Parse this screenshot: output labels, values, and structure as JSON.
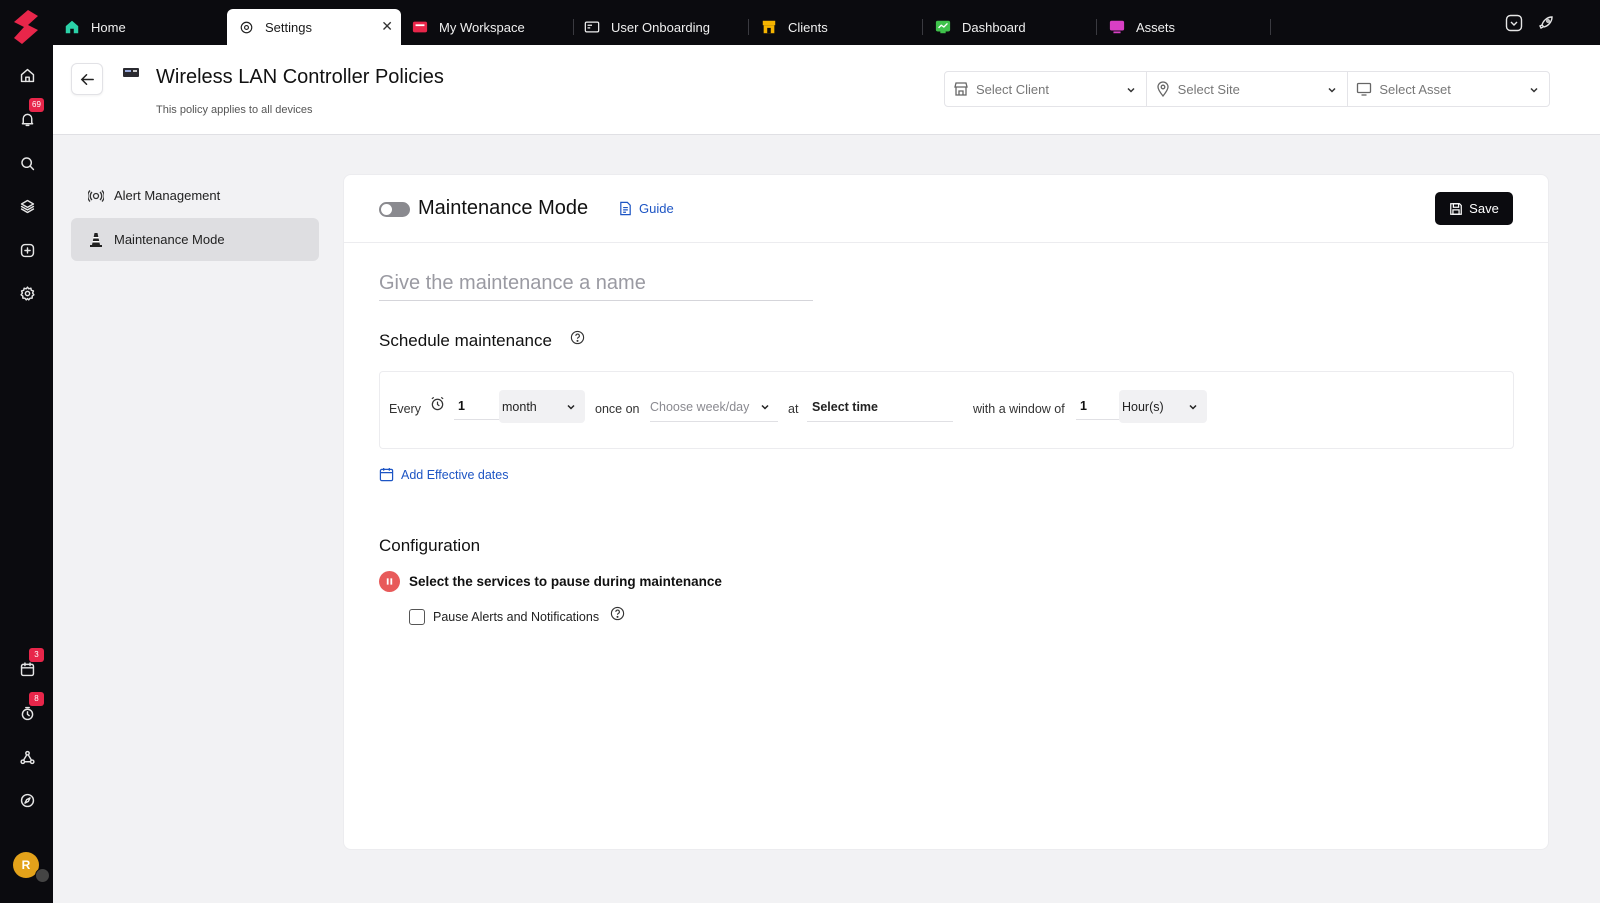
{
  "tabs": [
    {
      "label": "Home",
      "icon": "home-icon",
      "color": "#2bd2a8"
    },
    {
      "label": "Settings",
      "icon": "gear-icon",
      "active": true
    },
    {
      "label": "My Workspace",
      "icon": "workspace-icon",
      "color": "#e8264a"
    },
    {
      "label": "User Onboarding",
      "icon": "onboarding-icon"
    },
    {
      "label": "Clients",
      "icon": "store-icon",
      "color": "#f5b400"
    },
    {
      "label": "Dashboard",
      "icon": "dashboard-icon",
      "color": "#3fc24b"
    },
    {
      "label": "Assets",
      "icon": "assets-icon",
      "color": "#d83fc4"
    }
  ],
  "rail": {
    "notifications_badge": "69",
    "calendar_badge": "3",
    "timer_badge": "8",
    "avatar_initial": "R"
  },
  "header": {
    "title": "Wireless LAN Controller Policies",
    "subtitle": "This policy applies to all devices",
    "select_client": "Select Client",
    "select_site": "Select Site",
    "select_asset": "Select Asset"
  },
  "sidenav": {
    "items": [
      {
        "label": "Alert Management",
        "icon": "alert-signal-icon"
      },
      {
        "label": "Maintenance Mode",
        "icon": "traffic-cone-icon",
        "active": true
      }
    ]
  },
  "card": {
    "title": "Maintenance Mode",
    "guide_label": "Guide",
    "save_label": "Save",
    "name_placeholder": "Give the maintenance a name"
  },
  "schedule": {
    "title": "Schedule maintenance",
    "every_label": "Every",
    "interval_value": "1",
    "interval_unit": "month",
    "once_on_label": "once on",
    "weekday_placeholder": "Choose week/day",
    "at_label": "at",
    "time_placeholder": "Select time",
    "window_label": "with a window of",
    "window_value": "1",
    "window_unit": "Hour(s)",
    "add_dates_label": "Add Effective dates"
  },
  "configuration": {
    "title": "Configuration",
    "services_title": "Select the services to pause during maintenance",
    "pause_alerts_label": "Pause Alerts and Notifications",
    "pause_alerts_checked": false
  },
  "colors": {
    "accent": "#1d55c4",
    "dark": "#0b0b0f",
    "badge": "#e8264a",
    "pause": "#e85a5a"
  }
}
